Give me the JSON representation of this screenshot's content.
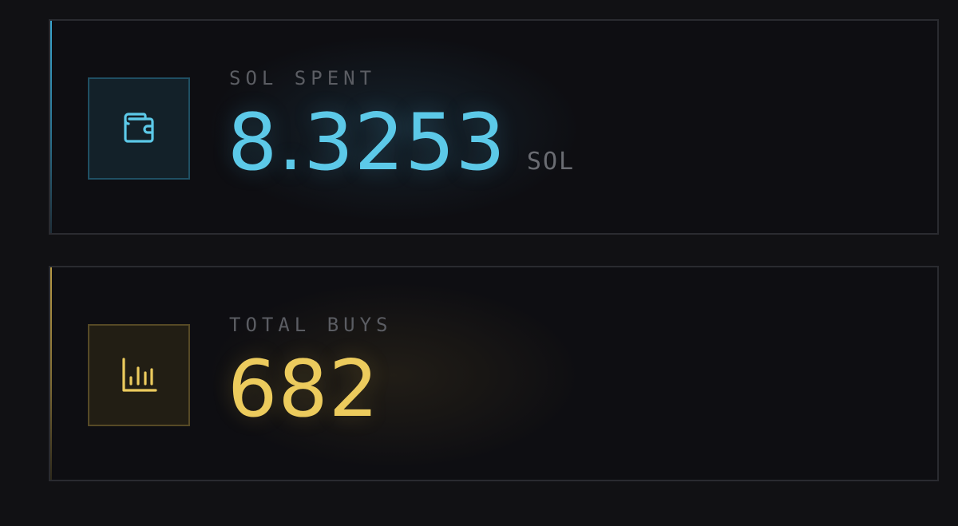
{
  "colors": {
    "background": "#111114",
    "card_background": "#0e0e12",
    "card_border": "#2a2b30",
    "sol_accent": "#5cc9e8",
    "buys_accent": "#eccb5d",
    "label_text": "#5b5d63",
    "unit_text": "#6a6c72"
  },
  "stats": {
    "sol_spent": {
      "icon": "wallet-icon",
      "label": "SOL SPENT",
      "value": "8.3253",
      "unit": "SOL"
    },
    "total_buys": {
      "icon": "bar-chart-icon",
      "label": "TOTAL BUYS",
      "value": "682"
    }
  }
}
